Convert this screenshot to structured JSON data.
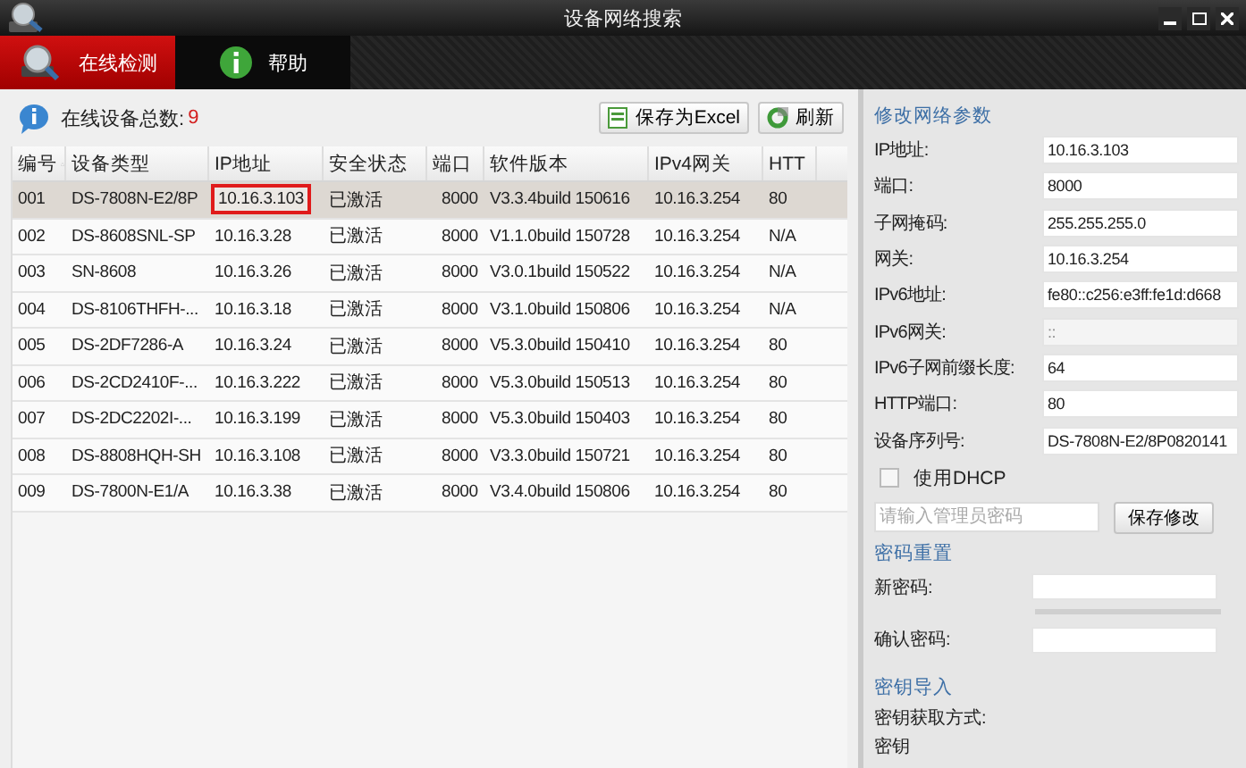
{
  "window": {
    "title": "设备网络搜索"
  },
  "tabs": [
    {
      "label": "在线检测",
      "kind": "search",
      "selected": true
    },
    {
      "label": "帮助",
      "kind": "help",
      "selected": false
    }
  ],
  "toolbar": {
    "count_label": "在线设备总数:",
    "count": "9",
    "buttons": [
      {
        "label": "保存为Excel",
        "kind": "excel"
      },
      {
        "label": "刷新",
        "kind": "refresh"
      }
    ]
  },
  "table": {
    "columns": [
      {
        "label": "编号",
        "sorted": true
      },
      {
        "label": "设备类型",
        "sorted": false
      },
      {
        "label": "IP地址",
        "sorted": false
      },
      {
        "label": "安全状态",
        "sorted": false
      },
      {
        "label": "端口",
        "sorted": false
      },
      {
        "label": "软件版本",
        "sorted": false
      },
      {
        "label": "IPv4网关",
        "sorted": false
      },
      {
        "label": "HTT",
        "sorted": false
      }
    ],
    "rows": [
      {
        "selected": true,
        "ip_highlighted": true,
        "cells": [
          "001",
          "DS-7808N-E2/8P",
          "10.16.3.103",
          "已激活",
          "8000",
          "V3.3.4build 150616",
          "10.16.3.254",
          "80"
        ]
      },
      {
        "selected": false,
        "ip_highlighted": false,
        "cells": [
          "002",
          "DS-8608SNL-SP",
          "10.16.3.28",
          "已激活",
          "8000",
          "V1.1.0build 150728",
          "10.16.3.254",
          "N/A"
        ]
      },
      {
        "selected": false,
        "ip_highlighted": false,
        "cells": [
          "003",
          "SN-8608",
          "10.16.3.26",
          "已激活",
          "8000",
          "V3.0.1build 150522",
          "10.16.3.254",
          "N/A"
        ]
      },
      {
        "selected": false,
        "ip_highlighted": false,
        "cells": [
          "004",
          "DS-8106THFH-...",
          "10.16.3.18",
          "已激活",
          "8000",
          "V3.1.0build 150806",
          "10.16.3.254",
          "N/A"
        ]
      },
      {
        "selected": false,
        "ip_highlighted": false,
        "cells": [
          "005",
          "DS-2DF7286-A",
          "10.16.3.24",
          "已激活",
          "8000",
          "V5.3.0build 150410",
          "10.16.3.254",
          "80"
        ]
      },
      {
        "selected": false,
        "ip_highlighted": false,
        "cells": [
          "006",
          "DS-2CD2410F-...",
          "10.16.3.222",
          "已激活",
          "8000",
          "V5.3.0build 150513",
          "10.16.3.254",
          "80"
        ]
      },
      {
        "selected": false,
        "ip_highlighted": false,
        "cells": [
          "007",
          "DS-2DC2202I-...",
          "10.16.3.199",
          "已激活",
          "8000",
          "V5.3.0build 150403",
          "10.16.3.254",
          "80"
        ]
      },
      {
        "selected": false,
        "ip_highlighted": false,
        "cells": [
          "008",
          "DS-8808HQH-SH",
          "10.16.3.108",
          "已激活",
          "8000",
          "V3.3.0build 150721",
          "10.16.3.254",
          "80"
        ]
      },
      {
        "selected": false,
        "ip_highlighted": false,
        "cells": [
          "009",
          "DS-7800N-E1/A",
          "10.16.3.38",
          "已激活",
          "8000",
          "V3.4.0build 150806",
          "10.16.3.254",
          "80"
        ]
      }
    ]
  },
  "network_panel": {
    "title": "修改网络参数",
    "fields": [
      {
        "label": "IP地址:",
        "value": "10.16.3.103",
        "disabled": false
      },
      {
        "label": "端口:",
        "value": "8000",
        "disabled": false
      },
      {
        "label": "子网掩码:",
        "value": "255.255.255.0",
        "disabled": false
      },
      {
        "label": "网关:",
        "value": "10.16.3.254",
        "disabled": false
      },
      {
        "label": "IPv6地址:",
        "value": "fe80::c256:e3ff:fe1d:d668",
        "disabled": false
      },
      {
        "label": "IPv6网关:",
        "value": "::",
        "disabled": true
      },
      {
        "label": "IPv6子网前缀长度:",
        "value": "64",
        "disabled": false
      },
      {
        "label": "HTTP端口:",
        "value": "80",
        "disabled": false
      },
      {
        "label": "设备序列号:",
        "value": "DS-7808N-E2/8P0820141",
        "disabled": false
      }
    ],
    "dhcp": {
      "label": "使用DHCP",
      "checked": false
    },
    "password": {
      "placeholder": "请输入管理员密码"
    },
    "save_button": "保存修改"
  },
  "password_reset": {
    "title": "密码重置",
    "new_password_label": "新密码:",
    "confirm_label": "确认密码:"
  },
  "key_import": {
    "title": "密钥导入",
    "method_label": "密钥获取方式:",
    "key_label": "密钥"
  }
}
